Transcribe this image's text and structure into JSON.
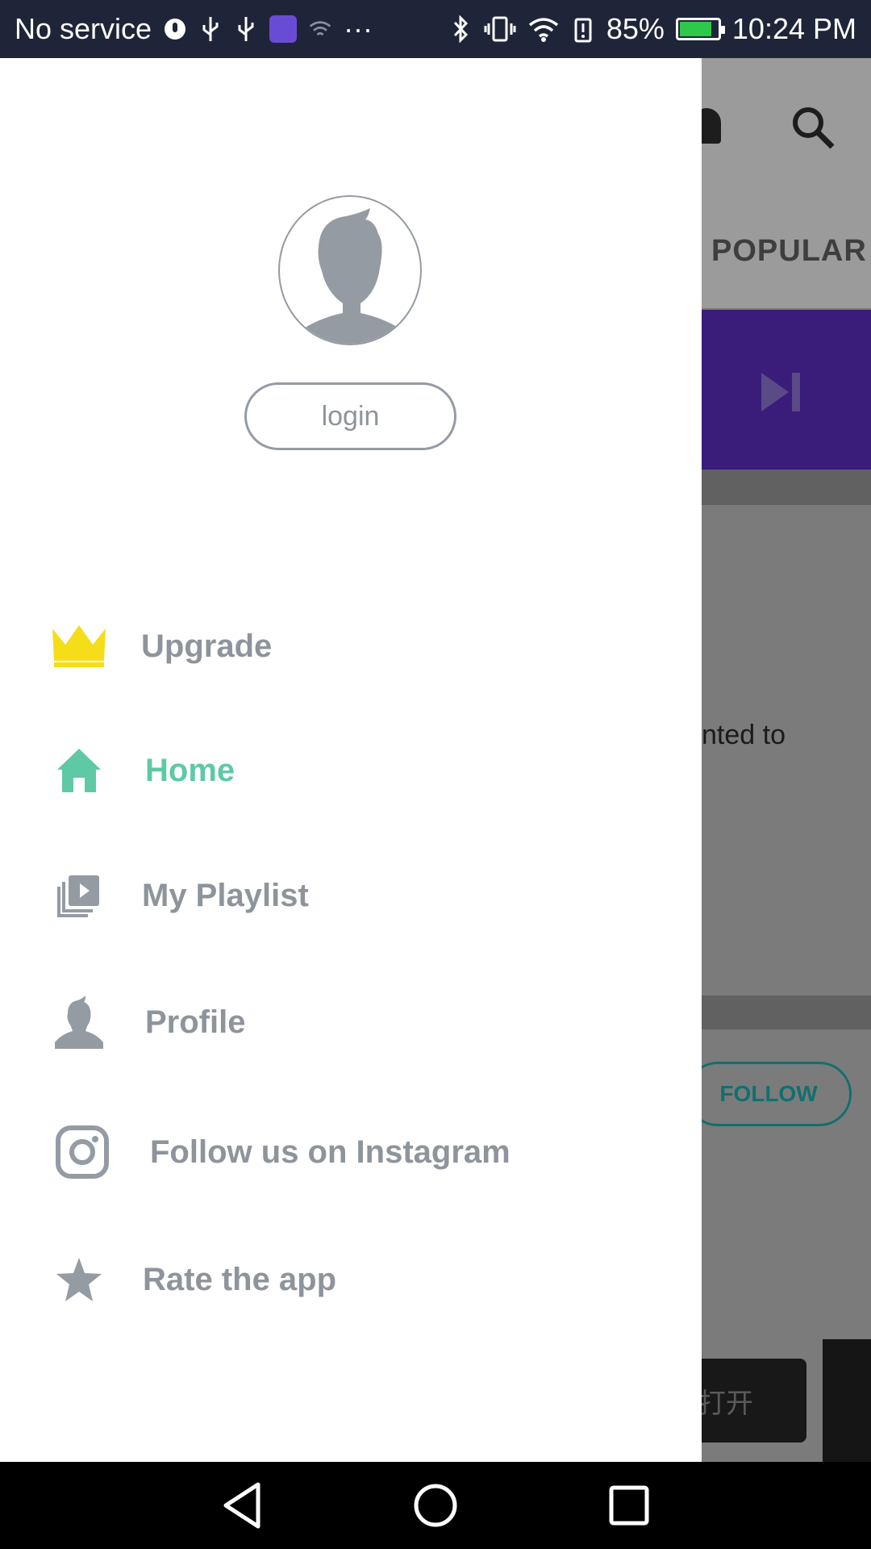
{
  "status_bar": {
    "carrier": "No service",
    "battery_percent": "85%",
    "battery_level": 0.85,
    "time": "10:24 PM",
    "more_indicator": "···"
  },
  "background_app": {
    "tab_label": "POPULAR",
    "text_snippet": "nted to",
    "follow_label": "FOLLOW",
    "open_label": "打开"
  },
  "drawer": {
    "login_label": "login",
    "menu": [
      {
        "label": "Upgrade",
        "icon": "crown-icon",
        "color": "#f5dd1a"
      },
      {
        "label": "Home",
        "icon": "home-icon",
        "active": true,
        "color": "#5ec9a4"
      },
      {
        "label": "My Playlist",
        "icon": "playlist-icon"
      },
      {
        "label": "Profile",
        "icon": "person-icon"
      },
      {
        "label": "Follow us on Instagram",
        "icon": "instagram-icon"
      },
      {
        "label": "Rate the app",
        "icon": "star-icon"
      }
    ]
  },
  "colors": {
    "drawer_text": "#8e949c",
    "accent": "#5ec9a4",
    "crown": "#f5dd1a",
    "status_bar": "#1f2538"
  }
}
